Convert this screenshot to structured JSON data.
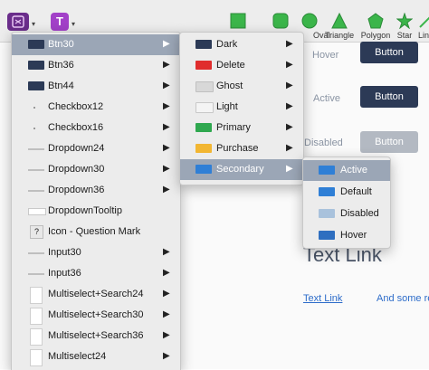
{
  "toolbar": {
    "items": [
      {
        "label": "Symbol",
        "shape": "symbol-icon"
      },
      {
        "label": "Text",
        "shape": "text-icon",
        "glyph": "T"
      },
      {
        "label": "Rectangle",
        "shape": "rectangle-icon"
      },
      {
        "label": "Rounded",
        "shape": "rounded-rectangle-icon"
      },
      {
        "label": "Oval",
        "shape": "oval-icon"
      },
      {
        "label": "Triangle",
        "shape": "triangle-icon"
      },
      {
        "label": "Polygon",
        "shape": "polygon-icon"
      },
      {
        "label": "Star",
        "shape": "star-icon"
      },
      {
        "label": "Line",
        "shape": "line-icon"
      }
    ],
    "shape_color": "#3bb54a"
  },
  "canvas": {
    "states": [
      {
        "label": "Hover",
        "button": "Button"
      },
      {
        "label": "Active",
        "button": "Button"
      },
      {
        "label": "Disabled",
        "button": "Button"
      }
    ],
    "big_link": "Text Link",
    "small_link": "Text Link",
    "trailing_text": "And some re"
  },
  "menu1": {
    "items": [
      {
        "label": "Btn30",
        "icon": "btn-icon",
        "submenu": true,
        "selected": true
      },
      {
        "label": "Btn36",
        "icon": "btn-icon",
        "submenu": true
      },
      {
        "label": "Btn44",
        "icon": "btn-icon",
        "submenu": true
      },
      {
        "label": "Checkbox12",
        "icon": "dot-icon",
        "submenu": true
      },
      {
        "label": "Checkbox16",
        "icon": "dot-icon",
        "submenu": true
      },
      {
        "label": "Dropdown24",
        "icon": "line-icon",
        "submenu": true
      },
      {
        "label": "Dropdown30",
        "icon": "line-icon",
        "submenu": true
      },
      {
        "label": "Dropdown36",
        "icon": "line-icon",
        "submenu": true
      },
      {
        "label": "DropdownTooltip",
        "icon": "input-icon",
        "submenu": false
      },
      {
        "label": "Icon - Question Mark",
        "icon": "question-icon",
        "submenu": false
      },
      {
        "label": "Input30",
        "icon": "line-icon",
        "submenu": true
      },
      {
        "label": "Input36",
        "icon": "line-icon",
        "submenu": true
      },
      {
        "label": "Multiselect+Search24",
        "icon": "page-icon",
        "submenu": true
      },
      {
        "label": "Multiselect+Search30",
        "icon": "page-icon",
        "submenu": true
      },
      {
        "label": "Multiselect+Search36",
        "icon": "page-icon",
        "submenu": true
      },
      {
        "label": "Multiselect24",
        "icon": "page-icon",
        "submenu": true
      }
    ]
  },
  "menu2": {
    "items": [
      {
        "label": "Dark",
        "color": "#2c3a56",
        "selected": false
      },
      {
        "label": "Delete",
        "color": "#e02d2d",
        "selected": false
      },
      {
        "label": "Ghost",
        "color": "#d8d8d8",
        "selected": false
      },
      {
        "label": "Light",
        "color": "#f4f4f4",
        "selected": false
      },
      {
        "label": "Primary",
        "color": "#2fa84f",
        "selected": false
      },
      {
        "label": "Purchase",
        "color": "#f2b632",
        "selected": false
      },
      {
        "label": "Secondary",
        "color": "#2f7fd6",
        "selected": true
      }
    ]
  },
  "menu3": {
    "items": [
      {
        "label": "Active",
        "color": "#2f7fd6",
        "selected": true
      },
      {
        "label": "Default",
        "color": "#2f7fd6",
        "selected": false
      },
      {
        "label": "Disabled",
        "color": "#a9c2dc",
        "selected": false
      },
      {
        "label": "Hover",
        "color": "#2f6fc0",
        "selected": false
      }
    ]
  },
  "colors": {
    "dark_button": "#2c3a56",
    "disabled_button": "#b3b9c2",
    "selection": "#9ba6b6",
    "link": "#2d6cc9"
  }
}
